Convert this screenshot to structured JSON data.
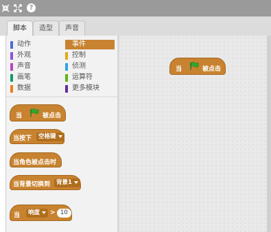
{
  "toolbar": {
    "icons": [
      "shrink-icon",
      "fullscreen-icon",
      "help-icon"
    ],
    "help_glyph": "?"
  },
  "tabs": [
    {
      "label": "脚本",
      "active": true
    },
    {
      "label": "造型",
      "active": false
    },
    {
      "label": "声音",
      "active": false
    }
  ],
  "categories": [
    {
      "label": "动作",
      "color": "#4a6cd4",
      "selected": false
    },
    {
      "label": "事件",
      "color": "#c88330",
      "selected": true
    },
    {
      "label": "外观",
      "color": "#8a55d7",
      "selected": false
    },
    {
      "label": "控制",
      "color": "#e1a91a",
      "selected": false
    },
    {
      "label": "声音",
      "color": "#bb42c3",
      "selected": false
    },
    {
      "label": "侦测",
      "color": "#2ca5e2",
      "selected": false
    },
    {
      "label": "画笔",
      "color": "#0e9a6c",
      "selected": false
    },
    {
      "label": "运算符",
      "color": "#5cb712",
      "selected": false
    },
    {
      "label": "数据",
      "color": "#ee7d16",
      "selected": false
    },
    {
      "label": "更多模块",
      "color": "#632d99",
      "selected": false
    }
  ],
  "blocks": {
    "flag_clicked": {
      "when": "当",
      "text": "被点击"
    },
    "key_pressed": {
      "text": "当按下",
      "key": "空格键"
    },
    "sprite_clicked": {
      "text": "当角色被点击时"
    },
    "backdrop_switch": {
      "text": "当背景切换到",
      "backdrop": "背景1"
    },
    "sensor": {
      "when": "当",
      "sensor": "响度",
      "op": ">",
      "value": "10"
    }
  },
  "script_area": {
    "block": {
      "when": "当",
      "text": "被点击"
    }
  },
  "colors": {
    "events": "#c88330",
    "flag": "#2fa82f"
  }
}
